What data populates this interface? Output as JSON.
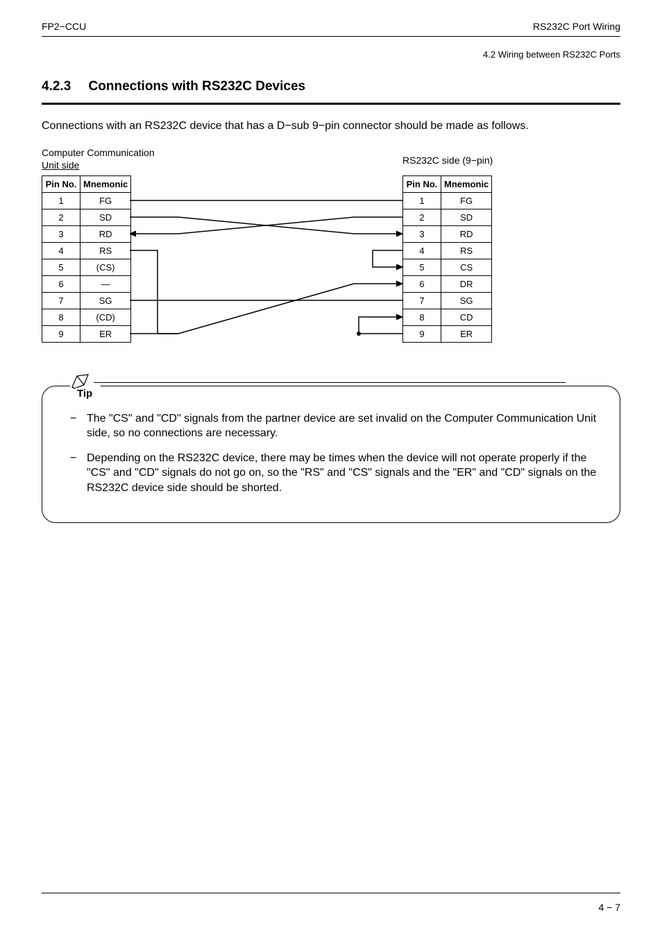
{
  "header": {
    "left": "FP2−CCU",
    "right": "RS232C Port Wiring"
  },
  "breadcrumb": "4.2   Wiring between RS232C Ports",
  "section": {
    "number": "4.2.3",
    "title": "Connections with RS232C Devices"
  },
  "intro": "Connections with an RS232C device that has a D−sub 9−pin connector should be made as follows.",
  "diagram": {
    "leftCaptionLine1": "Computer Communication",
    "leftCaptionLine2": "Unit side",
    "rightCaption": "RS232C side (9−pin)",
    "headers": {
      "pin": "Pin No.",
      "mnemonic": "Mnemonic"
    },
    "leftPins": [
      {
        "pin": "1",
        "mnemonic": "FG"
      },
      {
        "pin": "2",
        "mnemonic": "SD"
      },
      {
        "pin": "3",
        "mnemonic": "RD"
      },
      {
        "pin": "4",
        "mnemonic": "RS"
      },
      {
        "pin": "5",
        "mnemonic": "(CS)"
      },
      {
        "pin": "6",
        "mnemonic": "—"
      },
      {
        "pin": "7",
        "mnemonic": "SG"
      },
      {
        "pin": "8",
        "mnemonic": "(CD)"
      },
      {
        "pin": "9",
        "mnemonic": "ER"
      }
    ],
    "rightPins": [
      {
        "pin": "1",
        "mnemonic": "FG"
      },
      {
        "pin": "2",
        "mnemonic": "SD"
      },
      {
        "pin": "3",
        "mnemonic": "RD"
      },
      {
        "pin": "4",
        "mnemonic": "RS"
      },
      {
        "pin": "5",
        "mnemonic": "CS"
      },
      {
        "pin": "6",
        "mnemonic": "DR"
      },
      {
        "pin": "7",
        "mnemonic": "SG"
      },
      {
        "pin": "8",
        "mnemonic": "CD"
      },
      {
        "pin": "9",
        "mnemonic": "ER"
      }
    ]
  },
  "tip": {
    "label": "Tip",
    "items": [
      "The \"CS\" and \"CD\" signals from the partner device are set invalid on the Computer Communication Unit side, so no connections are necessary.",
      "Depending on the RS232C device, there may be times when the device will not operate properly if the \"CS\" and \"CD\" signals do not go on, so the \"RS\" and \"CS\" signals and the \"ER\" and \"CD\" signals on the RS232C device side should be shorted."
    ]
  },
  "pageNumber": "4 − 7"
}
